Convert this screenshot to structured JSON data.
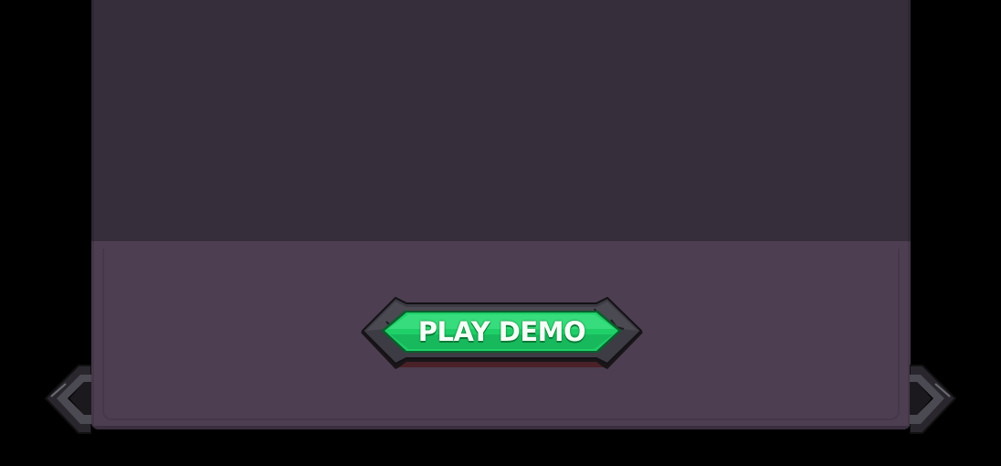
{
  "game_screen": {
    "play_button": {
      "label": "PLAY DEMO",
      "icon": "stone-framed-button"
    },
    "prev_arrow": {
      "icon": "chevron-left-icon"
    },
    "next_arrow": {
      "icon": "chevron-right-icon"
    }
  },
  "colors": {
    "background": "#000000",
    "panel_top": "#372e3c",
    "panel_bottom": "#4d3f51",
    "button_green": "#1fd068",
    "button_green_dark": "#0f9a47",
    "stone_frame": "#3d3b43",
    "stone_frame_light": "#6a6870"
  }
}
